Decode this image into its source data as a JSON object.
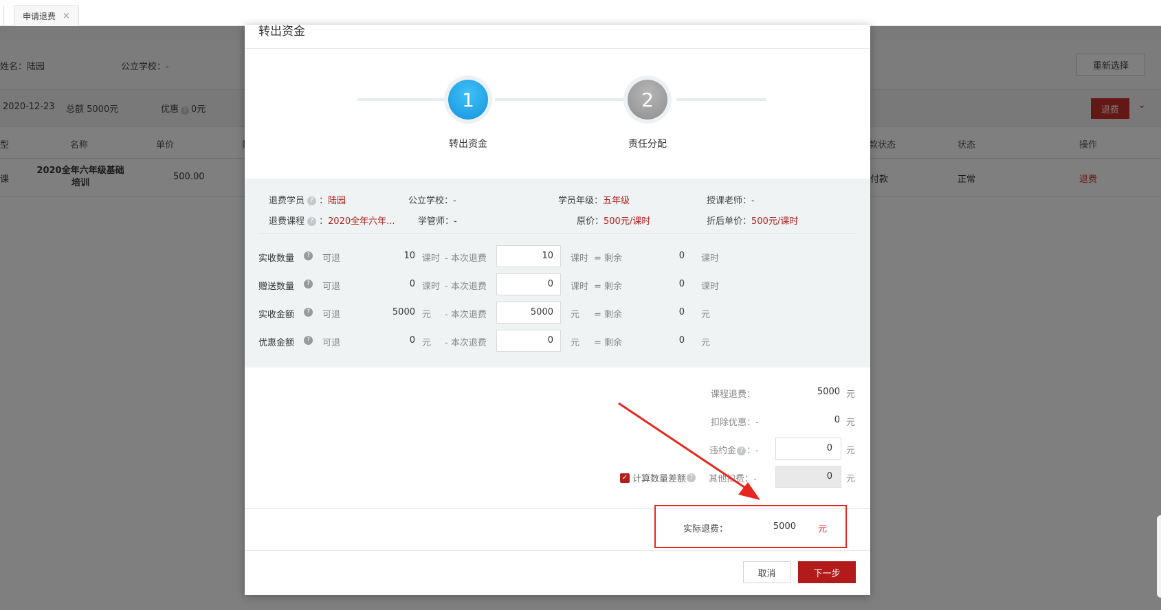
{
  "tabbar": {
    "tab_label": "申请退费",
    "close_glyph": "×"
  },
  "background": {
    "student_name": "姓名：陆园",
    "public_school": "公立学校：-",
    "reselect_label": "重新选择",
    "date": "2020-12-23",
    "total": "总额 5000元",
    "discount_label": "优惠",
    "discount_value": "0元",
    "refund_top_label": "退费",
    "columns": [
      "型",
      "名称",
      "单价",
      "数",
      "款状态",
      "状态",
      "操作"
    ],
    "row": {
      "type": "课",
      "name": "2020全年六年级基础培训",
      "price": "500.00",
      "pay_status": "付款",
      "status": "正常",
      "action": "退费"
    }
  },
  "modal": {
    "title": "转出资金",
    "steps": [
      {
        "number": "1",
        "label": "转出资金",
        "active": true
      },
      {
        "number": "2",
        "label": "责任分配",
        "active": false
      }
    ],
    "info": {
      "refund_student_label": "退费学员",
      "refund_student_value": "陆园",
      "public_school": "公立学校：-",
      "grade_label": "学员年级：",
      "grade_value": "五年级",
      "teacher": "授课老师：-",
      "refund_course_label": "退费课程",
      "refund_course_value": "2020全年六年...",
      "manager": "学管师：-",
      "original_price_label": "原价：",
      "original_price_value": "500元/课时",
      "discount_price_label": "折后单价：",
      "discount_price_value": "500元/课时"
    },
    "qty_rows": [
      {
        "label": "实收数量",
        "refundable_label": "可退",
        "refundable": "10",
        "unit": "课时",
        "this_label": "- 本次退费",
        "this_value": "10",
        "remain_label": "= 剩余",
        "remain": "0"
      },
      {
        "label": "赠送数量",
        "refundable_label": "可退",
        "refundable": "0",
        "unit": "课时",
        "this_label": "- 本次退费",
        "this_value": "0",
        "remain_label": "= 剩余",
        "remain": "0"
      },
      {
        "label": "实收金额",
        "refundable_label": "可退",
        "refundable": "5000",
        "unit": "元",
        "this_label": "- 本次退费",
        "this_value": "5000",
        "remain_label": "= 剩余",
        "remain": "0"
      },
      {
        "label": "优惠金额",
        "refundable_label": "可退",
        "refundable": "0",
        "unit": "元",
        "this_label": "- 本次退费",
        "this_value": "0",
        "remain_label": "= 剩余",
        "remain": "0"
      }
    ],
    "fees": {
      "course_refund_label": "课程退费：",
      "course_refund_value": "5000",
      "deduct_discount_label": "扣除优惠：-",
      "deduct_discount_value": "0",
      "penalty_label": "违约金",
      "penalty_dash": "：-",
      "penalty_value": "0",
      "calc_diff_label": "计算数量差额",
      "other_fee_label": "其他扣费：-",
      "other_fee_value": "0",
      "unit": "元"
    },
    "actual": {
      "label": "实际退费：",
      "value": "5000",
      "unit": "元"
    },
    "buttons": {
      "cancel": "取消",
      "next": "下一步"
    }
  }
}
